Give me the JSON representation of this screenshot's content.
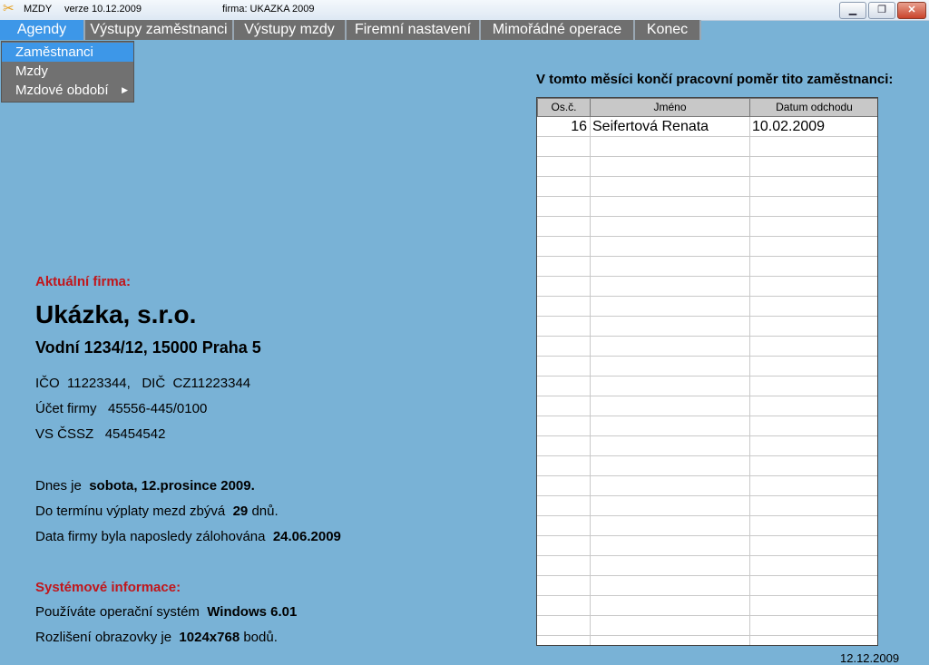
{
  "titlebar": {
    "app_name": "MZDY",
    "version": "verze 10.12.2009",
    "firm": "firma: UKAZKA 2009",
    "icons": {
      "app": "scissors-icon",
      "minimize": "minimize-icon",
      "restore": "restore-icon",
      "close": "close-icon"
    }
  },
  "menu": [
    {
      "label": "Agendy",
      "active": true
    },
    {
      "label": "Výstupy zaměstnanci"
    },
    {
      "label": "Výstupy mzdy"
    },
    {
      "label": "Firemní nastavení"
    },
    {
      "label": "Mimořádné operace"
    },
    {
      "label": "Konec"
    }
  ],
  "dropdown": [
    {
      "label": "Zaměstnanci",
      "active": true
    },
    {
      "label": "Mzdy"
    },
    {
      "label": "Mzdové období",
      "submenu": true
    }
  ],
  "company": {
    "heading": "Aktuální firma:",
    "name": "Ukázka, s.r.o.",
    "address": "Vodní 1234/12, 15000 Praha 5",
    "ico_label": "IČO",
    "ico": "11223344,",
    "dic_label": "DIČ",
    "dic": "CZ11223344",
    "account_label": "Účet firmy",
    "account": "45556-445/0100",
    "vs_label": "VS ČSSZ",
    "vs": "45454542"
  },
  "status": {
    "today_label": "Dnes je",
    "today": "sobota, 12.prosince 2009.",
    "payday_label": "Do termínu výplaty mezd zbývá",
    "payday_days": "29",
    "payday_unit": "dnů.",
    "backup_label": "Data firmy byla naposledy zálohována",
    "backup_date": "24.06.2009"
  },
  "system": {
    "heading": "Systémové informace:",
    "os_label": "Používáte operační systém",
    "os": "Windows 6.01",
    "res_label": "Rozlišení obrazovky je",
    "res": "1024x768",
    "res_unit": "bodů."
  },
  "leaving": {
    "title": "V tomto měsíci končí pracovní poměr tito zaměstnanci:",
    "columns": [
      "Os.č.",
      "Jméno",
      "Datum odchodu"
    ],
    "rows": [
      {
        "id": "16",
        "name": "Seifertová Renata",
        "date": "10.02.2009"
      }
    ]
  },
  "footer": {
    "date": "12.12.2009"
  },
  "colors": {
    "background": "#79b2d6",
    "menu": "#6f6f6f",
    "menu_active": "#3d97e8",
    "heading_red": "#c0161b"
  }
}
